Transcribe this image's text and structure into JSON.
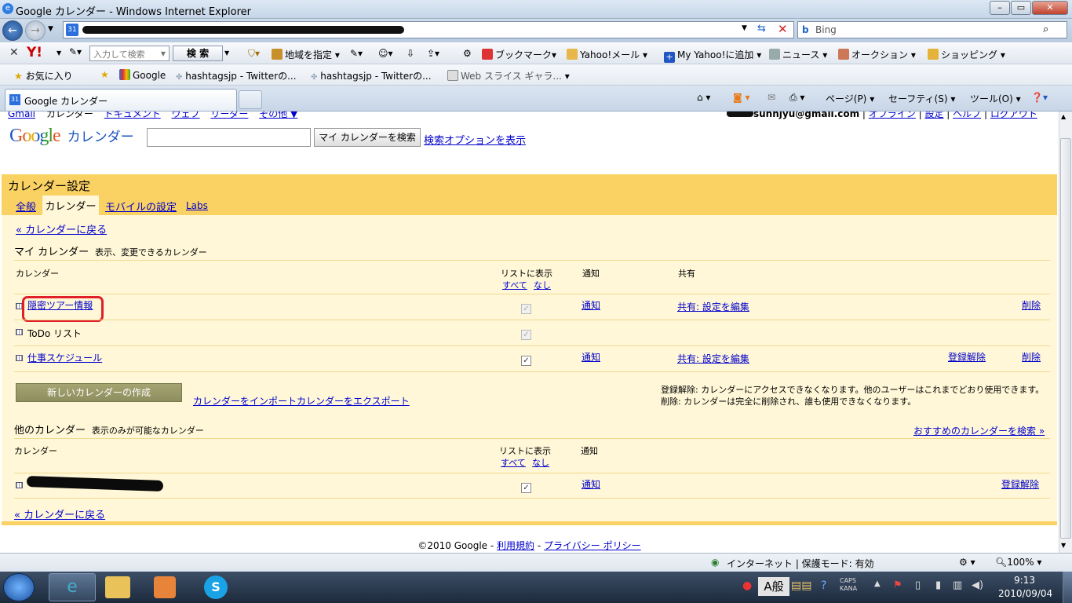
{
  "window": {
    "title": "Google カレンダー - Windows Internet Explorer"
  },
  "address": {
    "search_placeholder": "Bing"
  },
  "yahoo_toolbar": {
    "search_placeholder": "入力して検索",
    "search_button": "検 索",
    "region": "地域を指定",
    "bookmark": "ブックマーク",
    "mail": "Yahoo!メール",
    "add": "My Yahoo!に追加",
    "news": "ニュース",
    "auction": "オークション",
    "shopping": "ショッピング"
  },
  "favorites_bar": {
    "favorites": "お気に入り",
    "items": [
      "Google",
      "hashtagsjp - Twitterの...",
      "hashtagsjp - Twitterの...",
      "Web スライス ギャラ..."
    ]
  },
  "tab": {
    "label": "Google カレンダー"
  },
  "command_bar": {
    "page": "ページ(P)",
    "safety": "セーフティ(S)",
    "tools": "ツール(O)"
  },
  "google": {
    "top_links": [
      "Gmail",
      "カレンダー",
      "ドキュメント",
      "ウェブ",
      "リーダー",
      "その他 ▼"
    ],
    "user_email": "sunnjyu@gmail.com",
    "user_links": [
      "オフライン",
      "設定",
      "ヘルプ",
      "ログアウト"
    ],
    "logo_word": "Google",
    "logo_sub": "カレンダー",
    "search_button": "マイ カレンダーを検索",
    "search_options": "検索オプションを表示"
  },
  "settings": {
    "title": "カレンダー設定",
    "tabs": [
      "全般",
      "カレンダー",
      "モバイルの設定",
      "Labs"
    ],
    "back_link": "« カレンダーに戻る",
    "my_cal": {
      "heading": "マイ カレンダー",
      "sub": "表示、変更できるカレンダー",
      "col_calendar": "カレンダー",
      "col_list": "リストに表示",
      "col_all": "すべて",
      "col_none": "なし",
      "col_notify": "通知",
      "col_share": "共有",
      "rows": [
        {
          "name": "隠密ツアー情報",
          "notify": "通知",
          "share": "共有: 設定を編集",
          "unsubscribe": "",
          "delete": "削除",
          "link": true
        },
        {
          "name": "ToDo リスト",
          "notify": "",
          "share": "",
          "unsubscribe": "",
          "delete": "",
          "link": false
        },
        {
          "name": "仕事スケジュール",
          "notify": "通知",
          "share": "共有: 設定を編集",
          "unsubscribe": "登録解除",
          "delete": "削除",
          "link": true
        }
      ],
      "create_button": "新しいカレンダーの作成",
      "import": "カレンダーをインポート",
      "export": "カレンダーをエクスポート",
      "note1": "登録解除: カレンダーにアクセスできなくなります。他のユーザーはこれまでどおり使用できます。",
      "note2": "削除: カレンダーは完全に削除され、誰も使用できなくなります。"
    },
    "other_cal": {
      "heading": "他のカレンダー",
      "sub": "表示のみが可能なカレンダー",
      "recommend": "おすすめのカレンダーを検索 »",
      "col_calendar": "カレンダー",
      "col_list": "リストに表示",
      "col_all": "すべて",
      "col_none": "なし",
      "col_notify": "通知",
      "row": {
        "notify": "通知",
        "unsubscribe": "登録解除"
      }
    },
    "footer": {
      "copyright": "©2010 Google -",
      "terms": "利用規約",
      "sep": "-",
      "privacy": "プライバシー ポリシー"
    }
  },
  "status": {
    "zone": "インターネット | 保護モード: 有効",
    "zoom": "100%"
  },
  "taskbar": {
    "ime": "般",
    "time": "9:13",
    "date": "2010/09/04",
    "caps": "CAPS",
    "kana": "KANA"
  }
}
